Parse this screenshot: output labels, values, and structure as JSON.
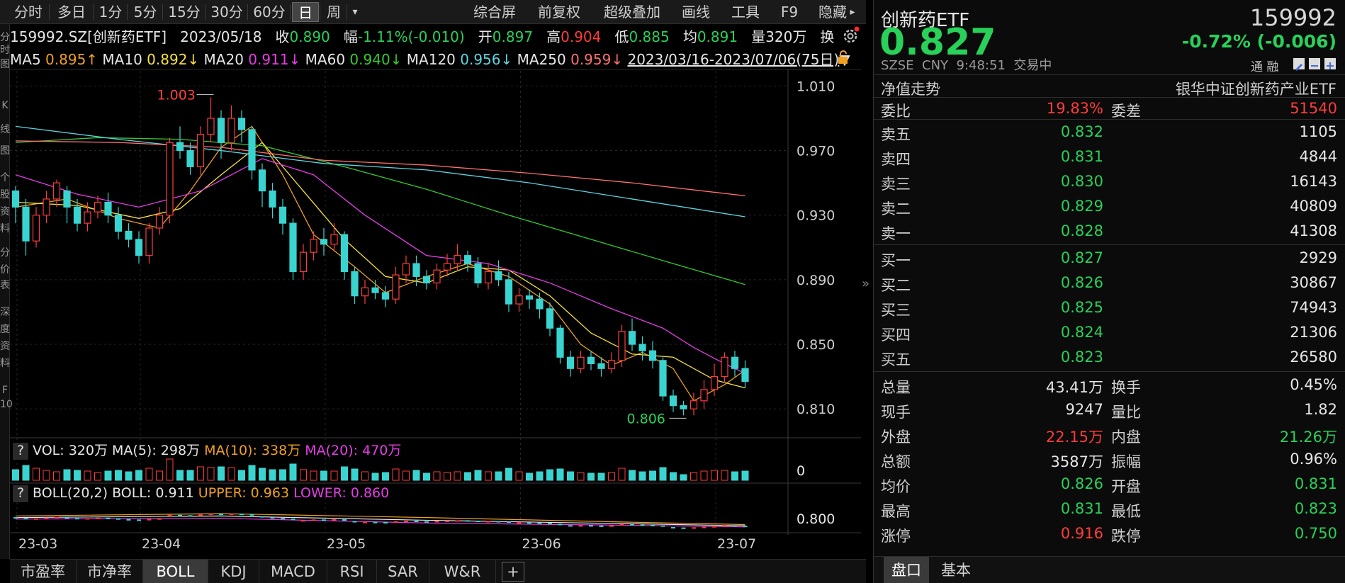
{
  "toolbar": {
    "periods": [
      "分时",
      "多日",
      "1分",
      "5分",
      "15分",
      "30分",
      "60分",
      "日",
      "周"
    ],
    "active_period": "日",
    "more_glyph": "▾",
    "tools": [
      "综合屏",
      "前复权",
      "超级叠加",
      "画线",
      "工具",
      "F9",
      "隐藏"
    ],
    "hide_arrow": "▸"
  },
  "left_strip": [
    "分",
    "时",
    "图",
    "K",
    "线",
    "图",
    "个",
    "股",
    "资",
    "料",
    "分",
    "价",
    "表",
    "深",
    "度",
    "资",
    "料",
    "F",
    "10"
  ],
  "info": {
    "code_name": "159992.SZ[创新药ETF]",
    "date": "2023/05/18",
    "close_label": "收",
    "close": "0.890",
    "change_label": "幅",
    "change": "-1.11%(-0.010)",
    "open_label": "开",
    "open": "0.897",
    "high_label": "高",
    "high": "0.904",
    "low_label": "低",
    "low": "0.885",
    "avg_label": "均",
    "avg": "0.891",
    "vol_label": "量",
    "vol": "320万",
    "swap_label": "换"
  },
  "ma_legend": [
    {
      "name": "MA5",
      "value": "0.895",
      "arrow": "↑",
      "color": "#f0a020"
    },
    {
      "name": "MA10",
      "value": "0.892",
      "arrow": "↓",
      "color": "#f7e23c"
    },
    {
      "name": "MA20",
      "value": "0.911",
      "arrow": "↓",
      "color": "#e83ce8"
    },
    {
      "name": "MA60",
      "value": "0.940",
      "arrow": "↓",
      "color": "#36c92e"
    },
    {
      "name": "MA120",
      "value": "0.956",
      "arrow": "↓",
      "color": "#5fd4e0"
    },
    {
      "name": "MA250",
      "value": "0.959",
      "arrow": "↓",
      "color": "#ff7070"
    }
  ],
  "range_text": "2023/03/16-2023/07/06(75日)",
  "range_dropdown": "▼",
  "chart_data": {
    "type": "candlestick",
    "y_ticks": [
      "1.010",
      "0.970",
      "0.930",
      "0.890",
      "0.850",
      "0.810"
    ],
    "ylim": [
      0.8,
      1.015
    ],
    "x_ticks": [
      "23-03",
      "23-04",
      "23-05",
      "23-06",
      "23-07"
    ],
    "x_tick_index": [
      0,
      12,
      30,
      49,
      68
    ],
    "annotations": [
      {
        "label": "1.003",
        "index": 19,
        "value": 1.003,
        "color": "#ff4040"
      },
      {
        "label": "0.806",
        "index": 65,
        "value": 0.806,
        "color": "#29d15a"
      }
    ],
    "candles": [
      [
        0.945,
        0.935,
        0.948,
        0.925
      ],
      [
        0.935,
        0.914,
        0.94,
        0.905
      ],
      [
        0.914,
        0.93,
        0.935,
        0.91
      ],
      [
        0.93,
        0.94,
        0.945,
        0.925
      ],
      [
        0.94,
        0.95,
        0.952,
        0.935
      ],
      [
        0.945,
        0.935,
        0.948,
        0.925
      ],
      [
        0.935,
        0.925,
        0.94,
        0.92
      ],
      [
        0.925,
        0.932,
        0.938,
        0.92
      ],
      [
        0.932,
        0.938,
        0.942,
        0.928
      ],
      [
        0.938,
        0.93,
        0.944,
        0.925
      ],
      [
        0.93,
        0.92,
        0.935,
        0.915
      ],
      [
        0.92,
        0.915,
        0.925,
        0.91
      ],
      [
        0.915,
        0.905,
        0.92,
        0.9
      ],
      [
        0.905,
        0.922,
        0.925,
        0.9
      ],
      [
        0.922,
        0.93,
        0.935,
        0.918
      ],
      [
        0.93,
        0.975,
        0.978,
        0.925
      ],
      [
        0.975,
        0.97,
        0.985,
        0.965
      ],
      [
        0.97,
        0.96,
        0.975,
        0.955
      ],
      [
        0.96,
        0.98,
        0.985,
        0.955
      ],
      [
        0.98,
        0.99,
        1.003,
        0.975
      ],
      [
        0.99,
        0.975,
        0.995,
        0.965
      ],
      [
        0.975,
        0.99,
        0.998,
        0.97
      ],
      [
        0.99,
        0.983,
        0.995,
        0.975
      ],
      [
        0.983,
        0.958,
        0.985,
        0.952
      ],
      [
        0.958,
        0.945,
        0.962,
        0.935
      ],
      [
        0.945,
        0.935,
        0.95,
        0.928
      ],
      [
        0.935,
        0.925,
        0.94,
        0.918
      ],
      [
        0.925,
        0.895,
        0.928,
        0.89
      ],
      [
        0.895,
        0.907,
        0.912,
        0.89
      ],
      [
        0.907,
        0.915,
        0.92,
        0.902
      ],
      [
        0.915,
        0.912,
        0.922,
        0.905
      ],
      [
        0.912,
        0.918,
        0.925,
        0.908
      ],
      [
        0.918,
        0.895,
        0.92,
        0.89
      ],
      [
        0.895,
        0.88,
        0.898,
        0.875
      ],
      [
        0.88,
        0.885,
        0.89,
        0.875
      ],
      [
        0.885,
        0.882,
        0.89,
        0.878
      ],
      [
        0.882,
        0.878,
        0.886,
        0.873
      ],
      [
        0.878,
        0.893,
        0.898,
        0.875
      ],
      [
        0.893,
        0.9,
        0.905,
        0.888
      ],
      [
        0.9,
        0.892,
        0.905,
        0.886
      ],
      [
        0.892,
        0.888,
        0.896,
        0.884
      ],
      [
        0.888,
        0.896,
        0.9,
        0.884
      ],
      [
        0.896,
        0.9,
        0.906,
        0.892
      ],
      [
        0.9,
        0.905,
        0.912,
        0.896
      ],
      [
        0.905,
        0.9,
        0.908,
        0.895
      ],
      [
        0.9,
        0.888,
        0.904,
        0.885
      ],
      [
        0.888,
        0.895,
        0.9,
        0.884
      ],
      [
        0.895,
        0.89,
        0.902,
        0.886
      ],
      [
        0.89,
        0.875,
        0.895,
        0.87
      ],
      [
        0.875,
        0.88,
        0.885,
        0.87
      ],
      [
        0.88,
        0.878,
        0.884,
        0.872
      ],
      [
        0.878,
        0.872,
        0.882,
        0.866
      ],
      [
        0.872,
        0.86,
        0.876,
        0.855
      ],
      [
        0.86,
        0.842,
        0.862,
        0.838
      ],
      [
        0.842,
        0.835,
        0.846,
        0.83
      ],
      [
        0.835,
        0.842,
        0.846,
        0.832
      ],
      [
        0.842,
        0.838,
        0.846,
        0.834
      ],
      [
        0.838,
        0.835,
        0.842,
        0.83
      ],
      [
        0.835,
        0.84,
        0.845,
        0.832
      ],
      [
        0.84,
        0.858,
        0.862,
        0.836
      ],
      [
        0.858,
        0.85,
        0.866,
        0.846
      ],
      [
        0.85,
        0.846,
        0.855,
        0.84
      ],
      [
        0.846,
        0.84,
        0.852,
        0.835
      ],
      [
        0.84,
        0.818,
        0.842,
        0.815
      ],
      [
        0.818,
        0.812,
        0.822,
        0.808
      ],
      [
        0.812,
        0.81,
        0.815,
        0.806
      ],
      [
        0.81,
        0.815,
        0.82,
        0.806
      ],
      [
        0.815,
        0.822,
        0.828,
        0.81
      ],
      [
        0.822,
        0.83,
        0.838,
        0.818
      ],
      [
        0.83,
        0.842,
        0.845,
        0.826
      ],
      [
        0.842,
        0.835,
        0.846,
        0.83
      ],
      [
        0.835,
        0.827,
        0.84,
        0.823
      ]
    ],
    "ma_lines": [
      {
        "name": "MA5",
        "color": "#f0a020",
        "points": [
          [
            0,
            0.935
          ],
          [
            5,
            0.94
          ],
          [
            10,
            0.928
          ],
          [
            14,
            0.922
          ],
          [
            17,
            0.945
          ],
          [
            20,
            0.972
          ],
          [
            23,
            0.985
          ],
          [
            26,
            0.955
          ],
          [
            29,
            0.918
          ],
          [
            33,
            0.898
          ],
          [
            36,
            0.882
          ],
          [
            40,
            0.892
          ],
          [
            44,
            0.9
          ],
          [
            48,
            0.892
          ],
          [
            52,
            0.875
          ],
          [
            55,
            0.85
          ],
          [
            58,
            0.837
          ],
          [
            61,
            0.845
          ],
          [
            64,
            0.835
          ],
          [
            66,
            0.815
          ],
          [
            69,
            0.825
          ],
          [
            71,
            0.834
          ]
        ]
      },
      {
        "name": "MA10",
        "color": "#f7e23c",
        "points": [
          [
            0,
            0.938
          ],
          [
            6,
            0.936
          ],
          [
            12,
            0.928
          ],
          [
            16,
            0.934
          ],
          [
            20,
            0.955
          ],
          [
            24,
            0.975
          ],
          [
            28,
            0.945
          ],
          [
            32,
            0.915
          ],
          [
            36,
            0.892
          ],
          [
            40,
            0.888
          ],
          [
            44,
            0.898
          ],
          [
            48,
            0.896
          ],
          [
            52,
            0.88
          ],
          [
            56,
            0.857
          ],
          [
            60,
            0.844
          ],
          [
            64,
            0.842
          ],
          [
            68,
            0.828
          ],
          [
            71,
            0.823
          ]
        ]
      },
      {
        "name": "MA20",
        "color": "#e83ce8",
        "points": [
          [
            0,
            0.955
          ],
          [
            6,
            0.943
          ],
          [
            12,
            0.935
          ],
          [
            18,
            0.945
          ],
          [
            24,
            0.965
          ],
          [
            29,
            0.955
          ],
          [
            34,
            0.93
          ],
          [
            40,
            0.905
          ],
          [
            46,
            0.9
          ],
          [
            52,
            0.888
          ],
          [
            58,
            0.872
          ],
          [
            63,
            0.86
          ],
          [
            66,
            0.848
          ],
          [
            69,
            0.838
          ],
          [
            71,
            0.832
          ]
        ]
      },
      {
        "name": "MA60",
        "color": "#36c92e",
        "points": [
          [
            0,
            0.975
          ],
          [
            8,
            0.978
          ],
          [
            16,
            0.977
          ],
          [
            24,
            0.973
          ],
          [
            32,
            0.96
          ],
          [
            40,
            0.946
          ],
          [
            48,
            0.93
          ],
          [
            56,
            0.915
          ],
          [
            64,
            0.9
          ],
          [
            71,
            0.887
          ]
        ]
      },
      {
        "name": "MA120",
        "color": "#5fd4e0",
        "points": [
          [
            0,
            0.985
          ],
          [
            10,
            0.977
          ],
          [
            20,
            0.97
          ],
          [
            30,
            0.962
          ],
          [
            40,
            0.958
          ],
          [
            50,
            0.95
          ],
          [
            60,
            0.94
          ],
          [
            71,
            0.929
          ]
        ]
      },
      {
        "name": "MA250",
        "color": "#ff7070",
        "points": [
          [
            0,
            0.976
          ],
          [
            10,
            0.975
          ],
          [
            20,
            0.972
          ],
          [
            30,
            0.964
          ],
          [
            40,
            0.961
          ],
          [
            50,
            0.956
          ],
          [
            60,
            0.95
          ],
          [
            71,
            0.942
          ]
        ]
      }
    ]
  },
  "vol_legend": {
    "q": "?",
    "text": "VOL: 320万",
    "ma5": "MA(5): 298万",
    "ma10": "MA(10): 338万",
    "ma20": "MA(20): 470万",
    "axis": "0"
  },
  "boll_legend": {
    "q": "?",
    "text": "BOLL(20,2)",
    "boll": "BOLL: 0.911",
    "upper": "UPPER: 0.963",
    "lower": "LOWER: 0.860",
    "axis": "0.800"
  },
  "bottom_tabs": [
    "市盈率",
    "市净率",
    "BOLL",
    "KDJ",
    "MACD",
    "RSI",
    "SAR",
    "W&R"
  ],
  "bottom_active": "BOLL",
  "bottom_add": "+",
  "quote": {
    "name": "创新药ETF",
    "code": "159992",
    "price": "0.827",
    "change": "-0.72% (-0.006)",
    "market": "SZSE",
    "currency": "CNY",
    "time": "9:48:51",
    "status": "交易中",
    "tongrong": "通 融",
    "nav_label": "净值走势",
    "index_name": "银华中证创新药产业ETF",
    "weibi_label": "委比",
    "weibi": "19.83%",
    "weicha_label": "委差",
    "weicha": "51540",
    "sells": [
      {
        "label": "卖五",
        "price": "0.832",
        "qty": "1105"
      },
      {
        "label": "卖四",
        "price": "0.831",
        "qty": "4844"
      },
      {
        "label": "卖三",
        "price": "0.830",
        "qty": "16143"
      },
      {
        "label": "卖二",
        "price": "0.829",
        "qty": "40809"
      },
      {
        "label": "卖一",
        "price": "0.828",
        "qty": "41308"
      }
    ],
    "buys": [
      {
        "label": "买一",
        "price": "0.827",
        "qty": "2929"
      },
      {
        "label": "买二",
        "price": "0.826",
        "qty": "30867"
      },
      {
        "label": "买三",
        "price": "0.825",
        "qty": "74943"
      },
      {
        "label": "买四",
        "price": "0.824",
        "qty": "21306"
      },
      {
        "label": "买五",
        "price": "0.823",
        "qty": "26580"
      }
    ],
    "stats": [
      {
        "l1": "总量",
        "v1": "43.41万",
        "c1": "#e6e6e6",
        "l2": "换手",
        "v2": "0.45%",
        "c2": "#e6e6e6"
      },
      {
        "l1": "现手",
        "v1": "9247",
        "c1": "#e6e6e6",
        "l2": "量比",
        "v2": "1.82",
        "c2": "#e6e6e6"
      },
      {
        "l1": "外盘",
        "v1": "22.15万",
        "c1": "#ff3c3c",
        "l2": "内盘",
        "v2": "21.26万",
        "c2": "#29d15a"
      },
      {
        "l1": "总额",
        "v1": "3587万",
        "c1": "#e6e6e6",
        "l2": "振幅",
        "v2": "0.96%",
        "c2": "#e6e6e6"
      },
      {
        "l1": "均价",
        "v1": "0.826",
        "c1": "#29d15a",
        "l2": "开盘",
        "v2": "0.831",
        "c2": "#29d15a"
      },
      {
        "l1": "最高",
        "v1": "0.831",
        "c1": "#29d15a",
        "l2": "最低",
        "v2": "0.823",
        "c2": "#29d15a"
      },
      {
        "l1": "涨停",
        "v1": "0.916",
        "c1": "#ff3c3c",
        "l2": "跌停",
        "v2": "0.750",
        "c2": "#29d15a"
      }
    ],
    "tabs": [
      "盘口",
      "基本"
    ],
    "active_tab": "盘口"
  },
  "colors": {
    "up": "#ff3c3c",
    "down": "#3ad4d0",
    "green": "#29d15a"
  }
}
